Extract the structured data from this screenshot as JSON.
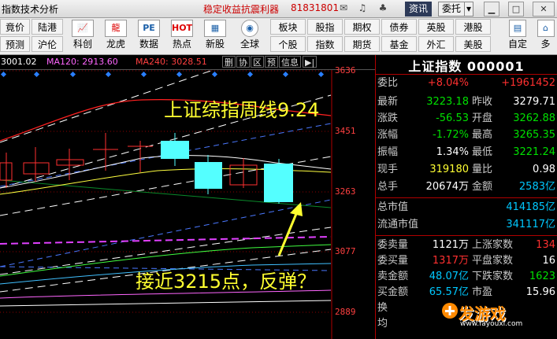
{
  "titlebar": {
    "app_title": "指数技术分析",
    "promo": "稳定收益抗震利器",
    "phone": "81831801",
    "btn_news": "资讯",
    "btn_trade": "委托"
  },
  "toolbar": {
    "row1": [
      "竟价",
      "陆港"
    ],
    "row2": [
      "预测",
      "沪伦"
    ],
    "big": [
      {
        "label": "科创",
        "icon": "chart-icon"
      },
      {
        "label": "龙虎",
        "icon": "dragon-icon"
      },
      {
        "label": "数据",
        "icon": "pe-icon"
      },
      {
        "label": "热点",
        "icon": "hot-icon"
      },
      {
        "label": "新股",
        "icon": "new-stock-icon"
      },
      {
        "label": "全球",
        "icon": "globe-icon"
      }
    ],
    "grid_row1": [
      "板块",
      "股指",
      "期权",
      "债券",
      "英股",
      "港股"
    ],
    "grid_row2": [
      "个股",
      "指数",
      "期货",
      "基金",
      "外汇",
      "美股"
    ],
    "custom": "自定",
    "more": "多"
  },
  "chartbar": {
    "ma_first": "3001.02",
    "ma120": "MA120: 2913.60",
    "ma240": "MA240: 3028.51",
    "tabs": [
      "删",
      "协",
      "区",
      "预",
      "信息"
    ]
  },
  "chart_axis": [
    "3636",
    "3451",
    "3263",
    "3077",
    "2889"
  ],
  "overlay": {
    "title": "上证综指周线9.24",
    "note": "接近3215点，反弹？"
  },
  "panel": {
    "title": "上证指数  000001",
    "rows": [
      {
        "l1": "委比",
        "v1": "+8.04%",
        "c1": "red",
        "l2": "",
        "v2": "+1961452",
        "c2": "red"
      },
      {
        "l1": "最新",
        "v1": "3223.18",
        "c1": "green",
        "l2": "昨收",
        "v2": "3279.71",
        "c2": "white"
      },
      {
        "l1": "涨跌",
        "v1": "-56.53",
        "c1": "green",
        "l2": "开盘",
        "v2": "3262.88",
        "c2": "green"
      },
      {
        "l1": "涨幅",
        "v1": "-1.72%",
        "c1": "green",
        "l2": "最高",
        "v2": "3265.35",
        "c2": "green"
      },
      {
        "l1": "振幅",
        "v1": "1.34%",
        "c1": "white",
        "l2": "最低",
        "v2": "3221.24",
        "c2": "green"
      },
      {
        "l1": "现手",
        "v1": "319180",
        "c1": "yellow",
        "l2": "量比",
        "v2": "0.98",
        "c2": "white"
      },
      {
        "l1": "总手",
        "v1": "20674万",
        "c1": "white",
        "l2": "金额",
        "v2": "2583亿",
        "c2": "cyan"
      }
    ],
    "rows2": [
      {
        "l1": "总市值",
        "v2": "414185亿"
      },
      {
        "l1": "流通市值",
        "v2": "341117亿"
      }
    ],
    "rows3": [
      {
        "l1": "委卖量",
        "v1": "1121万",
        "c1": "white",
        "l2": "上涨家数",
        "v2": "134",
        "c2": "red"
      },
      {
        "l1": "委买量",
        "v1": "1317万",
        "c1": "red",
        "l2": "平盘家数",
        "v2": "16",
        "c2": "white"
      },
      {
        "l1": "卖金额",
        "v1": "48.07亿",
        "c1": "cyan",
        "l2": "下跌家数",
        "v2": "1623",
        "c2": "green"
      },
      {
        "l1": "买金额",
        "v1": "65.57亿",
        "c1": "cyan",
        "l2": "市盈",
        "v2": "15.96",
        "c2": "white"
      }
    ],
    "partial": [
      "换",
      "均"
    ]
  },
  "watermark": {
    "text": "发游戏",
    "url": "www.fayouxi.com"
  }
}
